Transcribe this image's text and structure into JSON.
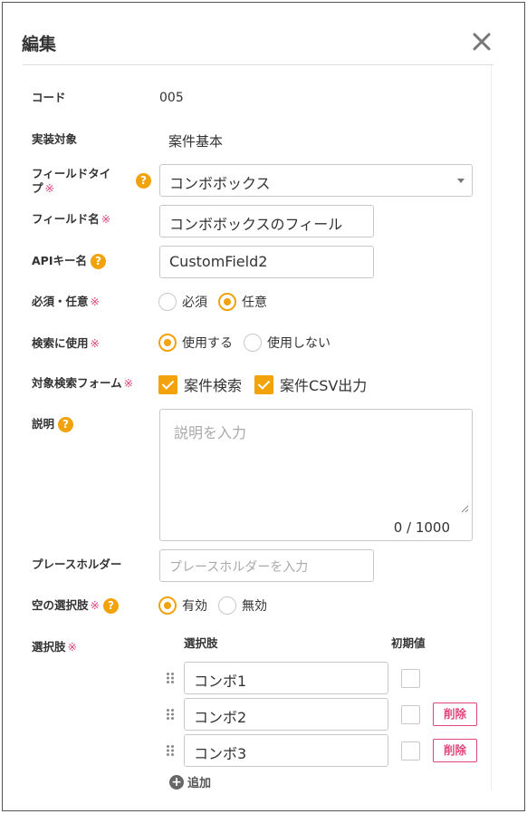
{
  "dialog": {
    "title": "編集",
    "close_icon": "close-icon"
  },
  "fields": {
    "code": {
      "label": "コード",
      "value": "005"
    },
    "target": {
      "label": "実装対象",
      "value": "案件基本"
    },
    "field_type": {
      "label_line1": "フィールドタイ",
      "label_line2": "プ",
      "required_mark": "※",
      "help_icon": "help-icon",
      "selected": "コンボボックス"
    },
    "field_name": {
      "label": "フィールド名",
      "required_mark": "※",
      "value": "コンボボックスのフィール"
    },
    "api_key": {
      "label": "APIキー名",
      "help_icon": "help-icon",
      "value": "CustomField2"
    },
    "required": {
      "label": "必須・任意",
      "required_mark": "※",
      "options": [
        "必須",
        "任意"
      ],
      "selected": "任意"
    },
    "search": {
      "label": "検索に使用",
      "required_mark": "※",
      "options": [
        "使用する",
        "使用しない"
      ],
      "selected": "使用する"
    },
    "search_form": {
      "label": "対象検索フォーム",
      "required_mark": "※",
      "options": [
        "案件検索",
        "案件CSV出力"
      ],
      "checked": [
        true,
        true
      ]
    },
    "description": {
      "label": "説明",
      "help_icon": "help-icon",
      "placeholder": "説明を入力",
      "counter": "0 / 1000"
    },
    "placeholder": {
      "label": "プレースホルダー",
      "placeholder": "プレースホルダーを入力"
    },
    "empty_option": {
      "label": "空の選択肢",
      "required_mark": "※",
      "help_icon": "help-icon",
      "options": [
        "有効",
        "無効"
      ],
      "selected": "有効"
    },
    "choices": {
      "label": "選択肢",
      "required_mark": "※",
      "col_choice": "選択肢",
      "col_default": "初期値",
      "items": [
        {
          "value": "コンボ1",
          "default": false,
          "delete_label": ""
        },
        {
          "value": "コンボ2",
          "default": false,
          "delete_label": "削除"
        },
        {
          "value": "コンボ3",
          "default": false,
          "delete_label": "削除"
        }
      ],
      "add_label": "追加"
    }
  },
  "colors": {
    "accent": "#f2a20a",
    "required": "#e0457a",
    "border": "#c8c8c8"
  }
}
